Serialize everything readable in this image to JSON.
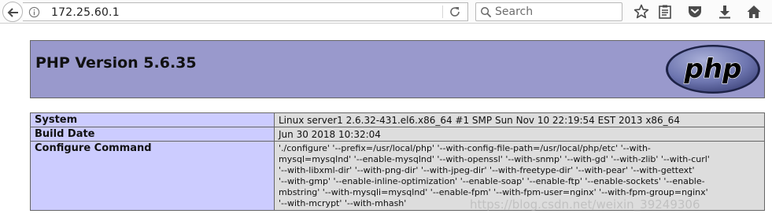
{
  "browser": {
    "url": "172.25.60.1",
    "search_placeholder": "Search"
  },
  "page": {
    "title": "PHP Version 5.6.35",
    "logo_text": "php",
    "rows": [
      {
        "label": "System",
        "value": "Linux server1 2.6.32-431.el6.x86_64 #1 SMP Sun Nov 10 22:19:54 EST 2013 x86_64"
      },
      {
        "label": "Build Date",
        "value": "Jun 30 2018 10:32:04"
      },
      {
        "label": "Configure Command",
        "value": "'./configure' '--prefix=/usr/local/php' '--with-config-file-path=/usr/local/php/etc' '--with-\nmysql=mysqlnd' '--enable-mysqlnd' '--with-openssl' '--with-snmp' '--with-gd' '--with-zlib' '--with-curl'\n'--with-libxml-dir' '--with-png-dir' '--with-jpeg-dir' '--with-freetype-dir' '--with-pear' '--with-gettext'\n'--with-gmp' '--enable-inline-optimization' '--enable-soap' '--enable-ftp' '--enable-sockets' '--enable-\nmbstring' '--with-mysqli=mysqlnd' '--enable-fpm' '--with-fpm-user=nginx' '--with-fpm-group=nginx'\n'--with-mcrypt' '--with-mhash'"
      }
    ]
  },
  "watermark": "https://blog.csdn.net/weixin_39249306"
}
